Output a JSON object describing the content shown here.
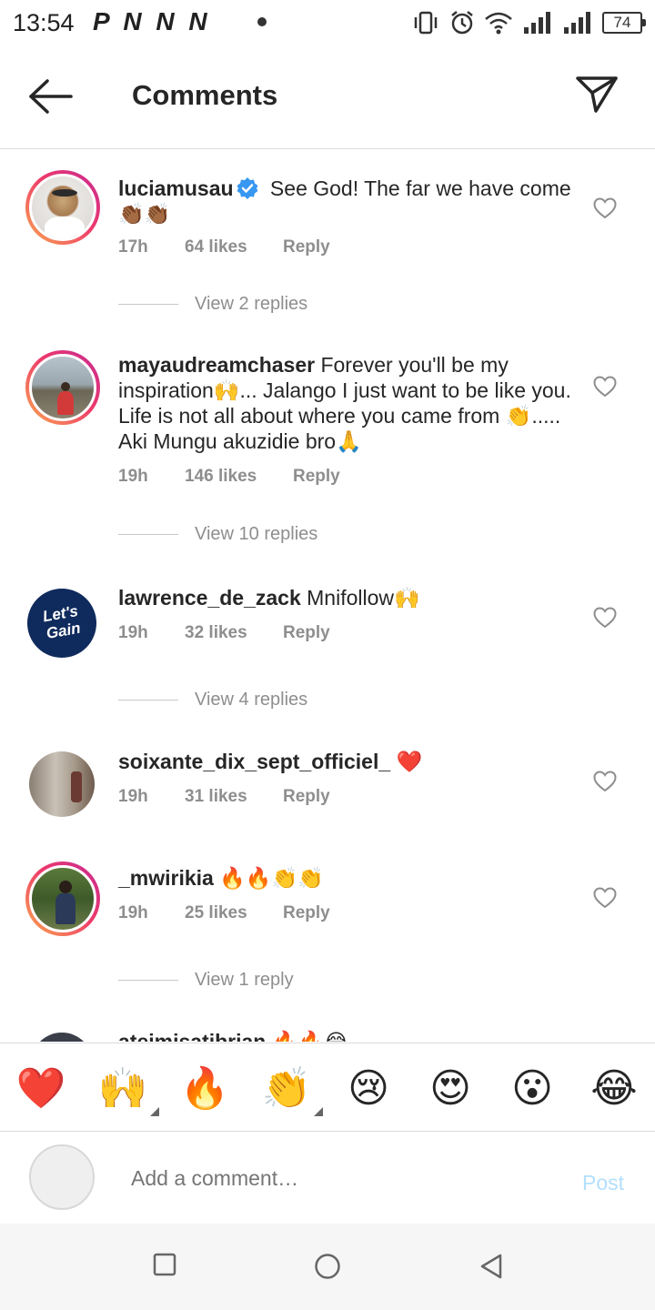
{
  "status_bar": {
    "time": "13:54",
    "notification_letters": "P N N N",
    "battery": "74"
  },
  "header": {
    "title": "Comments"
  },
  "comments": [
    {
      "username": "luciamusau",
      "verified": true,
      "text": " See God! The far we have come 👏🏾👏🏾",
      "time": "17h",
      "likes": "64 likes",
      "reply": "Reply",
      "view_replies": "View 2 replies"
    },
    {
      "username": "mayaudreamchaser",
      "verified": false,
      "text": " Forever you'll be my inspiration🙌... Jalango I just want to be like you. Life is not all about where you came from 👏..... Aki Mungu akuzidie bro🙏",
      "time": "19h",
      "likes": "146 likes",
      "reply": "Reply",
      "view_replies": "View 10 replies"
    },
    {
      "username": "lawrence_de_zack",
      "verified": false,
      "text": " Mnifollow🙌",
      "time": "19h",
      "likes": "32 likes",
      "reply": "Reply",
      "view_replies": "View 4 replies",
      "avatar_text_1": "Let's",
      "avatar_text_2": "Gain"
    },
    {
      "username": "soixante_dix_sept_officiel_",
      "verified": false,
      "text": " ❤️",
      "time": "19h",
      "likes": "31 likes",
      "reply": "Reply"
    },
    {
      "username": "_mwirikia",
      "verified": false,
      "text": " 🔥🔥👏👏",
      "time": "19h",
      "likes": "25 likes",
      "reply": "Reply",
      "view_replies": "View 1 reply"
    },
    {
      "username": "ateimisatibrian",
      "verified": false,
      "text": " 🔥🔥😂"
    }
  ],
  "emoji_bar": [
    "❤️",
    "🙌",
    "🔥",
    "👏",
    "😢",
    "😍",
    "😮",
    "😂"
  ],
  "compose": {
    "placeholder": "Add a comment…",
    "post_label": "Post"
  },
  "colors": {
    "link_blue_disabled": "#b2dffc",
    "secondary_text": "#8e8e8e",
    "verified_blue": "#3897f0"
  }
}
